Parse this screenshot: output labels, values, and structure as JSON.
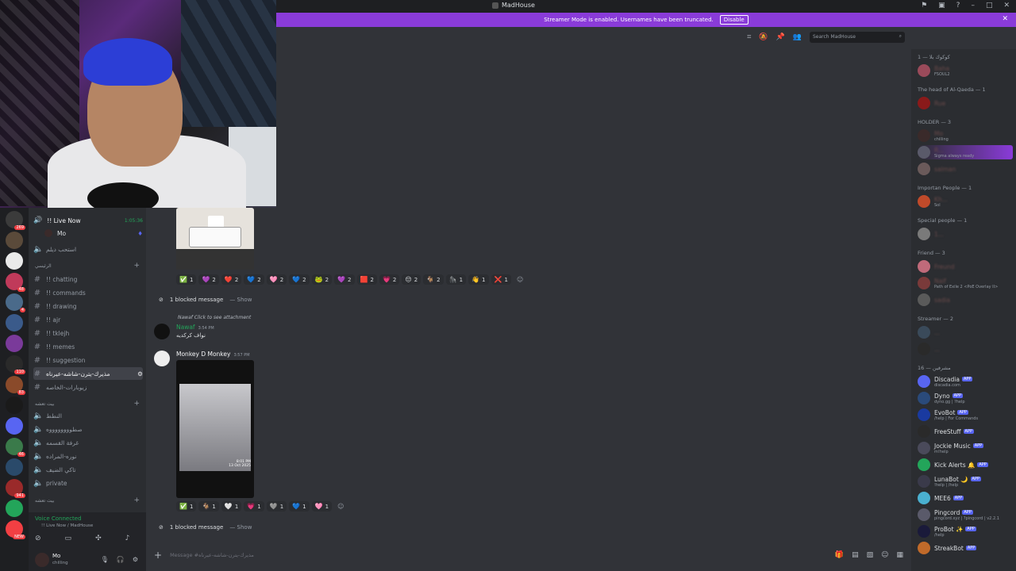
{
  "window": {
    "title": "MadHouse"
  },
  "banner": {
    "text": "Streamer Mode is enabled. Usernames have been truncated.",
    "button": "Disable"
  },
  "header": {
    "search_placeholder": "Search MadHouse"
  },
  "guilds": [
    {
      "badge": "269",
      "color": "#3b3b3b"
    },
    {
      "badge": "",
      "color": "#5a4a3a"
    },
    {
      "badge": "",
      "color": "#eaeaea"
    },
    {
      "badge": "48",
      "color": "#c03a5a"
    },
    {
      "badge": "4",
      "color": "#4a6a8a"
    },
    {
      "badge": "",
      "color": "#3a5a8a"
    },
    {
      "badge": "",
      "color": "#7a3a9a"
    },
    {
      "badge": "110",
      "color": "#2a2a2a"
    },
    {
      "badge": "83",
      "color": "#8a4a2a"
    },
    {
      "badge": "",
      "color": "#1a1a1a"
    },
    {
      "badge": "",
      "color": "#5865f2"
    },
    {
      "badge": "46",
      "color": "#3a7a4a"
    },
    {
      "badge": "",
      "color": "#2a4a6a"
    },
    {
      "badge": "941",
      "color": "#9a2a2a"
    },
    {
      "badge": "",
      "color": "#23a55a"
    },
    {
      "badge": "NEW",
      "color": "#f23f43"
    }
  ],
  "sidebar": {
    "live": {
      "label": "!! Live Now",
      "time": "1:05:36",
      "user": "Mo"
    },
    "voice_room": "استحب ديلم",
    "category_text": "الرئيسي",
    "channels": [
      {
        "icon": "#",
        "label": "!! chatting"
      },
      {
        "icon": "#",
        "label": "!! commands"
      },
      {
        "icon": "#",
        "label": "!! drawing"
      },
      {
        "icon": "#",
        "label": "!! ajr"
      },
      {
        "icon": "#",
        "label": "!! tklejh"
      },
      {
        "icon": "#",
        "label": "!! memes"
      },
      {
        "icon": "#",
        "label": "!! suggestion"
      },
      {
        "icon": "#",
        "label": "مذيرك-يترن-شاشه-عيرناه"
      },
      {
        "icon": "#",
        "label": "زيوبارات-الخاصه"
      }
    ],
    "category_voice": "بيت تعشه",
    "voice_channels": [
      {
        "label": "النطط"
      },
      {
        "label": "صطووووووووه"
      },
      {
        "label": "غرفة القسمه"
      },
      {
        "label": "نوره-المراده"
      },
      {
        "label": "تاكي الضيف"
      },
      {
        "label": "private"
      }
    ],
    "category_bottom": "بيت تعشه"
  },
  "voice_status": {
    "title": "Voice Connected",
    "subtitle": "!! Live Now / MadHouse"
  },
  "user": {
    "name": "Mo",
    "status": "chilling"
  },
  "messages": {
    "reactions1": [
      {
        "e": "✅",
        "n": "1"
      },
      {
        "e": "💜",
        "n": "2"
      },
      {
        "e": "❤️",
        "n": "2"
      },
      {
        "e": "💙",
        "n": "2"
      },
      {
        "e": "🩷",
        "n": "2"
      },
      {
        "e": "💙",
        "n": "2"
      },
      {
        "e": "🐸",
        "n": "2"
      },
      {
        "e": "💜",
        "n": "2"
      },
      {
        "e": "🟥",
        "n": "2"
      },
      {
        "e": "💗",
        "n": "2"
      },
      {
        "e": "😔",
        "n": "2"
      },
      {
        "e": "🐐",
        "n": "2"
      },
      {
        "e": "🦍",
        "n": "1"
      },
      {
        "e": "👋",
        "n": "1"
      },
      {
        "e": "❌",
        "n": "1"
      }
    ],
    "blocked1": "1 blocked message",
    "blocked_show": "— Show",
    "reply_ref": "Nawaf Click to see attachment",
    "nawaf": {
      "author": "Nawaf",
      "time": "3:54 PM",
      "body": "نواف كركديه"
    },
    "monkey": {
      "author": "Monkey D Monkey",
      "time": "3:57 PM",
      "overlay": "8:01 PM\n13 Oct 2025"
    },
    "reactions2": [
      {
        "e": "✅",
        "n": "1"
      },
      {
        "e": "🐐",
        "n": "1"
      },
      {
        "e": "🤍",
        "n": "1"
      },
      {
        "e": "💗",
        "n": "1"
      },
      {
        "e": "🩶",
        "n": "1"
      },
      {
        "e": "💙",
        "n": "1"
      },
      {
        "e": "🩷",
        "n": "1"
      }
    ],
    "blocked2": "1 blocked message"
  },
  "composer": {
    "placeholder": "Message #مذيرك-يترن-شاشه-عيرناه"
  },
  "members": {
    "groups": [
      {
        "header": "1 — كوكوك بلا",
        "items": [
          {
            "name": "Baha",
            "sub": "FSOUL2",
            "color": "#9a4a5a"
          }
        ]
      },
      {
        "header": "The head of Al-Qaeda — 1",
        "items": [
          {
            "name": "Rue",
            "sub": "",
            "color": "#8a1a1a"
          }
        ]
      },
      {
        "header": "HOLDER — 3",
        "items": [
          {
            "name": "Mo",
            "sub": "chilling",
            "color": "#3a2a2a"
          },
          {
            "name": "R...",
            "sub": "Sigma always ready",
            "color": "#5a5a6a"
          },
          {
            "name": "salman",
            "sub": "",
            "color": "#6a5a5a"
          }
        ]
      },
      {
        "header": "Importan People — 1",
        "items": [
          {
            "name": "Kh...",
            "sub": "Sol",
            "color": "#c04a2a"
          }
        ]
      },
      {
        "header": "Special people — 1",
        "items": [
          {
            "name": "1...",
            "sub": "",
            "color": "#7a7a7a"
          }
        ]
      },
      {
        "header": "Friend — 3",
        "items": [
          {
            "name": "Freund",
            "sub": "",
            "color": "#c06a7a"
          },
          {
            "name": "Naif",
            "sub": "Path of Exile 2 <PoE Overlay II>",
            "color": "#7a3a3a"
          },
          {
            "name": "sadia",
            "sub": "",
            "color": "#5a5a5a"
          }
        ]
      },
      {
        "header": "Streamer — 2",
        "items": [
          {
            "name": "...",
            "sub": "",
            "color": "#3a4a5a"
          },
          {
            "name": "...",
            "sub": "",
            "color": "#2a2a2a"
          }
        ]
      },
      {
        "header": "16 — مشرفين",
        "items": [
          {
            "name": "Discadia",
            "sub": "discadia.com",
            "color": "#5865f2",
            "app": "APP"
          },
          {
            "name": "Dyno",
            "sub": "dyno.gg | ?help",
            "color": "#2a4a7a",
            "app": "APP"
          },
          {
            "name": "EvoBot",
            "sub": "/help | For Commands",
            "color": "#1a3aa0",
            "app": "APP"
          },
          {
            "name": "FreeStuff",
            "sub": "",
            "color": "#2a2a2a",
            "app": "APP"
          },
          {
            "name": "Jockie Music",
            "sub": "m!help",
            "color": "#4a4a5a",
            "app": "APP"
          },
          {
            "name": "Kick Alerts 🔔",
            "sub": "",
            "color": "#23a55a",
            "app": "APP"
          },
          {
            "name": "LunaBot 🌙",
            "sub": "!help | /help",
            "color": "#3a3a4a",
            "app": "APP"
          },
          {
            "name": "MEE6",
            "sub": "",
            "color": "#4ab0d0",
            "app": "APP"
          },
          {
            "name": "Pingcord",
            "sub": "pingcord.xyz | ?pingcord | v2.2.1",
            "color": "#5a5a6a",
            "app": "APP"
          },
          {
            "name": "ProBot ✨",
            "sub": "/help",
            "color": "#1a1a3a",
            "app": "APP"
          },
          {
            "name": "StreakBot",
            "sub": "",
            "color": "#c06a2a",
            "app": "APP"
          }
        ]
      }
    ]
  }
}
